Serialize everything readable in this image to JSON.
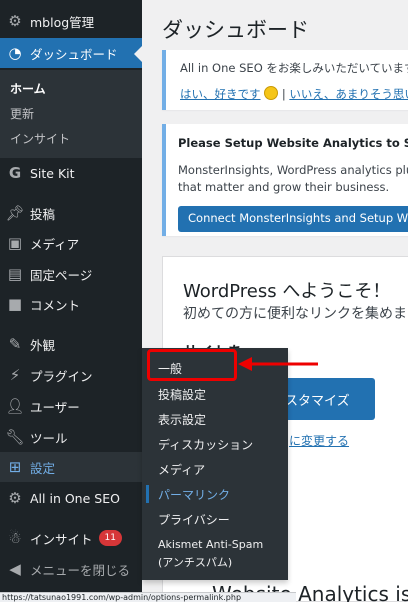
{
  "sidebar": {
    "site_name": "mblog管理",
    "dashboard": "ダッシュボード",
    "dashboard_sub": [
      "ホーム",
      "更新",
      "インサイト"
    ],
    "site_kit": "Site Kit",
    "posts": "投稿",
    "media": "メディア",
    "pages": "固定ページ",
    "comments": "コメント",
    "appearance": "外観",
    "plugins": "プラグイン",
    "users": "ユーザー",
    "tools": "ツール",
    "settings": "設定",
    "aioseo": "All in One SEO",
    "insights": "インサイト",
    "insights_badge": "11",
    "collapse": "メニューを閉じる"
  },
  "flyout": {
    "items": [
      "一般",
      "投稿設定",
      "表示設定",
      "ディスカッション",
      "メディア",
      "パーマリンク",
      "プライバシー",
      "Akismet Anti-Spam",
      "(アンチスパム)"
    ]
  },
  "main": {
    "title": "ダッシュボード",
    "aioseo_notice": {
      "message": "All in One SEO をお楽しみいただいています",
      "yes_link": "はい、好きです",
      "separator": " | ",
      "no_link": "いいえ、あまりそう思い"
    },
    "mi_notice": {
      "heading": "Please Setup Website Analytics to See Aud",
      "desc_line1": "MonsterInsights, WordPress analytics plugin,",
      "desc_line2": "that matter and grow their business.",
      "button": "Connect MonsterInsights and Setup Websit"
    },
    "welcome": {
      "title": "WordPress へようこそ！",
      "subtitle": "初めての方に便利なリンクを集めま",
      "bold_partial": "サイトを",
      "customize_button": "スタマイズ",
      "change_link": "に変更する"
    },
    "bottom_title": "Website Analytics is n"
  },
  "statusbar": {
    "url": "https://tatsunao1991.com/wp-admin/options-permalink.php"
  },
  "colors": {
    "sidebar_bg": "#1d2327",
    "accent": "#2271b1",
    "highlight": "#e00000",
    "badge": "#d63638"
  }
}
